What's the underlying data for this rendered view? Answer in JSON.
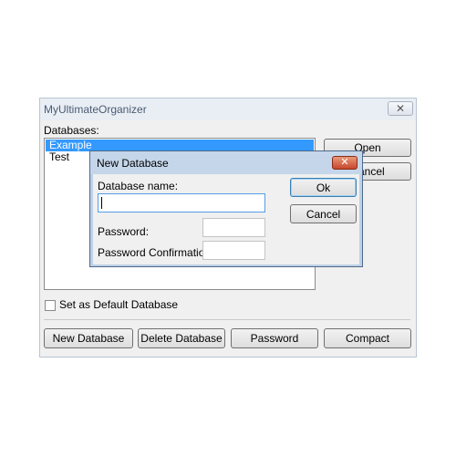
{
  "main_window": {
    "title": "MyUltimateOrganizer",
    "close_glyph": "✕",
    "databases_label": "Databases:",
    "databases": [
      "Example",
      "Test"
    ],
    "selected_database": "Example",
    "open_button": "Open",
    "cancel_button": "Cancel",
    "default_checkbox_label": "Set as Default Database",
    "default_checked": false,
    "buttons": {
      "new_database": "New Database",
      "delete_database": "Delete Database",
      "password": "Password",
      "compact": "Compact"
    }
  },
  "dialog": {
    "title": "New Database",
    "close_glyph": "✕",
    "name_label": "Database name:",
    "name_value": "",
    "password_label": "Password:",
    "password_value": "",
    "password_confirm_label": "Password Confirmation:",
    "password_confirm_value": "",
    "ok_button": "Ok",
    "cancel_button": "Cancel"
  },
  "colors": {
    "selection": "#3399ff",
    "dialog_frame": "#bdd0e6",
    "close_red": "#c8462a"
  },
  "icons": {
    "main_close": "close-icon",
    "dialog_close": "close-icon"
  }
}
